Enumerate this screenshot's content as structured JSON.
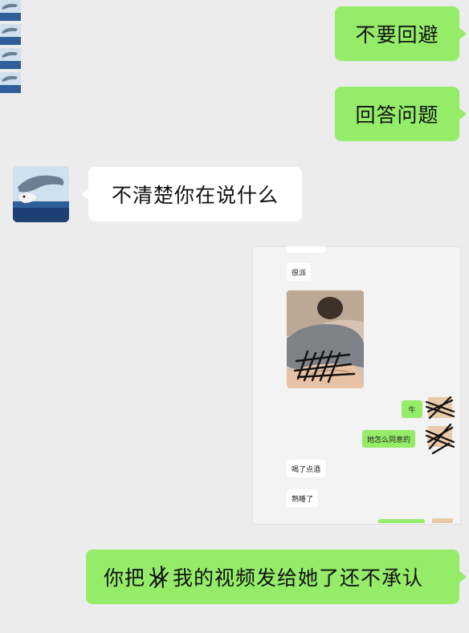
{
  "messages": {
    "sent_1": "不要回避",
    "sent_2": "回答问题",
    "received_1": "不清楚你在说什么",
    "sent_3": "你把",
    "sent_3_tail": "我的视频发给她了还不承认"
  },
  "embedded_screenshot": {
    "msg_1": "很派",
    "msg_2": "牛",
    "msg_3": "她怎么同意的",
    "msg_4": "喝了点酒",
    "msg_5": "熟睡了"
  },
  "colors": {
    "sent_bubble": "#95ec69",
    "received_bubble": "#ffffff",
    "background": "#ececec"
  }
}
